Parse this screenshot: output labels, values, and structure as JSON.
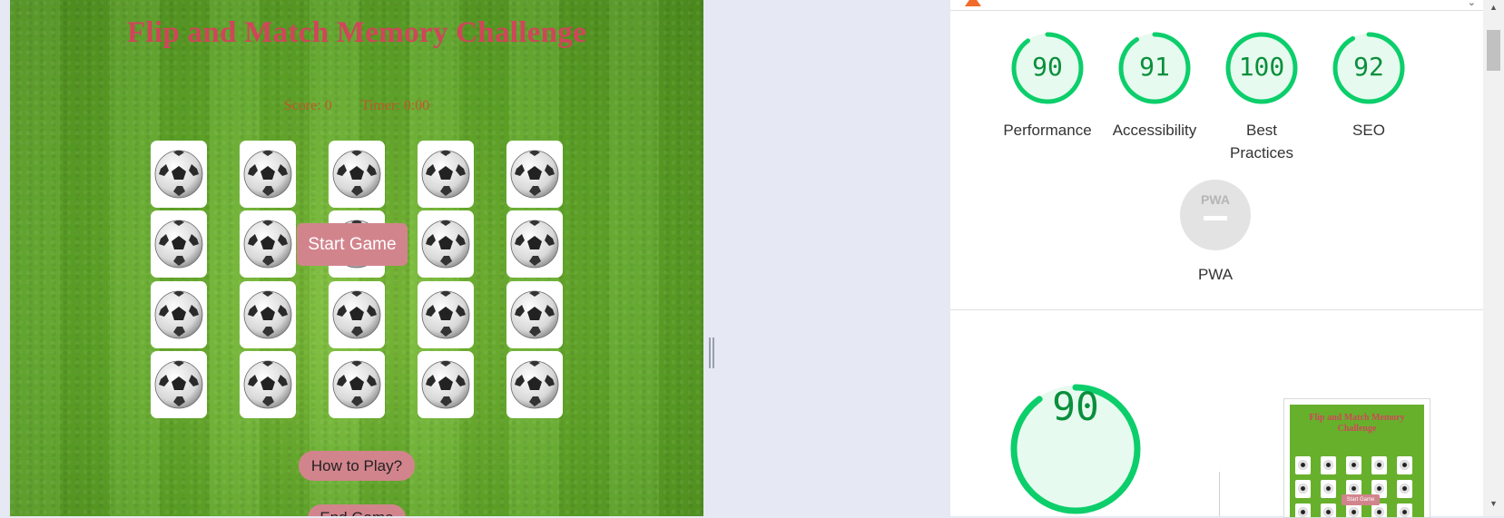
{
  "game": {
    "title": "Flip and Match Memory Challenge",
    "score": "Score: 0",
    "timer": "Timer: 0:00",
    "start_button": "Start Game",
    "howto_button": "How to Play?",
    "end_button": "End Game"
  },
  "lighthouse": {
    "scores": [
      {
        "value": "90",
        "label": "Performance",
        "color": "#0cce6b"
      },
      {
        "value": "91",
        "label": "Accessibility",
        "color": "#0cce6b"
      },
      {
        "value": "100",
        "label": "Best Practices",
        "color": "#0cce6b"
      },
      {
        "value": "92",
        "label": "SEO",
        "color": "#0cce6b"
      }
    ],
    "pwa_label": "PWA",
    "pwa_badge": "PWA",
    "main_score": "90",
    "thumbnail_title": "Flip and Match Memory Challenge",
    "thumbnail_button": "Start Game"
  }
}
